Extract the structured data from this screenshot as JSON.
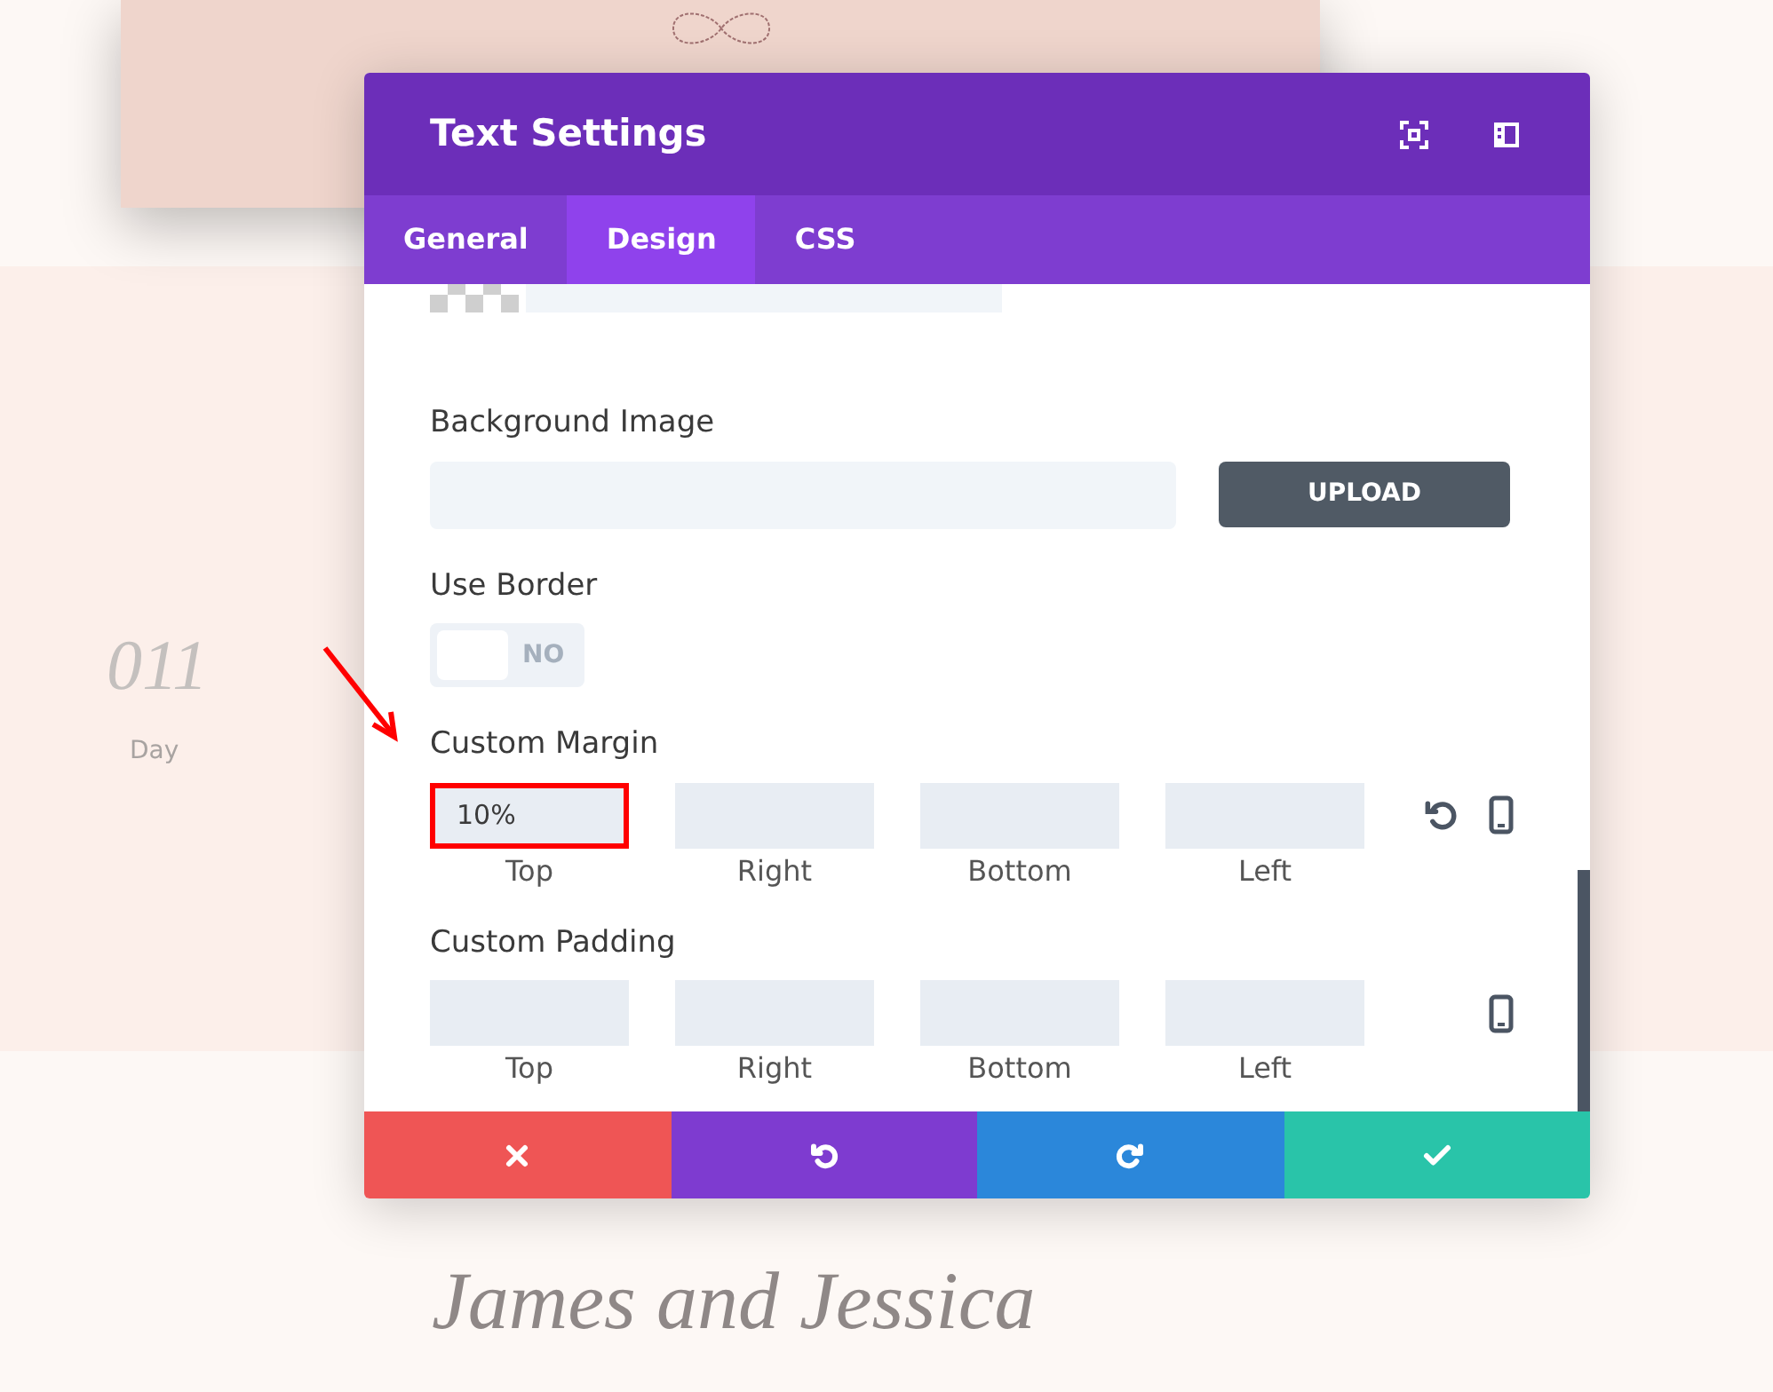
{
  "background": {
    "counter": {
      "value": "011",
      "unit": "Day"
    },
    "names": "James and Jessica"
  },
  "modal": {
    "title": "Text Settings",
    "tabs": [
      {
        "label": "General",
        "selected": false
      },
      {
        "label": "Design",
        "selected": true
      },
      {
        "label": "CSS",
        "selected": false
      }
    ],
    "sections": [
      {
        "kind": "image",
        "label": "Background Image",
        "button": "UPLOAD"
      },
      {
        "kind": "toggle",
        "label": "Use Border",
        "on": false,
        "state_label": "NO"
      },
      {
        "kind": "spacing",
        "label": "Custom Margin",
        "reset": true,
        "fields": [
          {
            "value": "10%",
            "caption": "Top",
            "highlighted": true
          },
          {
            "caption": "Right",
            "highlighted": false
          },
          {
            "caption": "Bottom",
            "highlighted": false
          },
          {
            "caption": "Left",
            "highlighted": false
          }
        ]
      },
      {
        "kind": "spacing",
        "label": "Custom Padding",
        "reset": false,
        "fields": [
          {
            "caption": "Top",
            "highlighted": false
          },
          {
            "caption": "Right",
            "highlighted": false
          },
          {
            "caption": "Bottom",
            "highlighted": false
          },
          {
            "caption": "Left",
            "highlighted": false
          }
        ]
      }
    ],
    "actions": [
      {
        "kind": "cancel",
        "color": "#ef5555"
      },
      {
        "kind": "undo",
        "color": "#7e3bd0"
      },
      {
        "kind": "redo",
        "color": "#2b87da"
      },
      {
        "kind": "save",
        "color": "#29c4a9"
      }
    ]
  }
}
